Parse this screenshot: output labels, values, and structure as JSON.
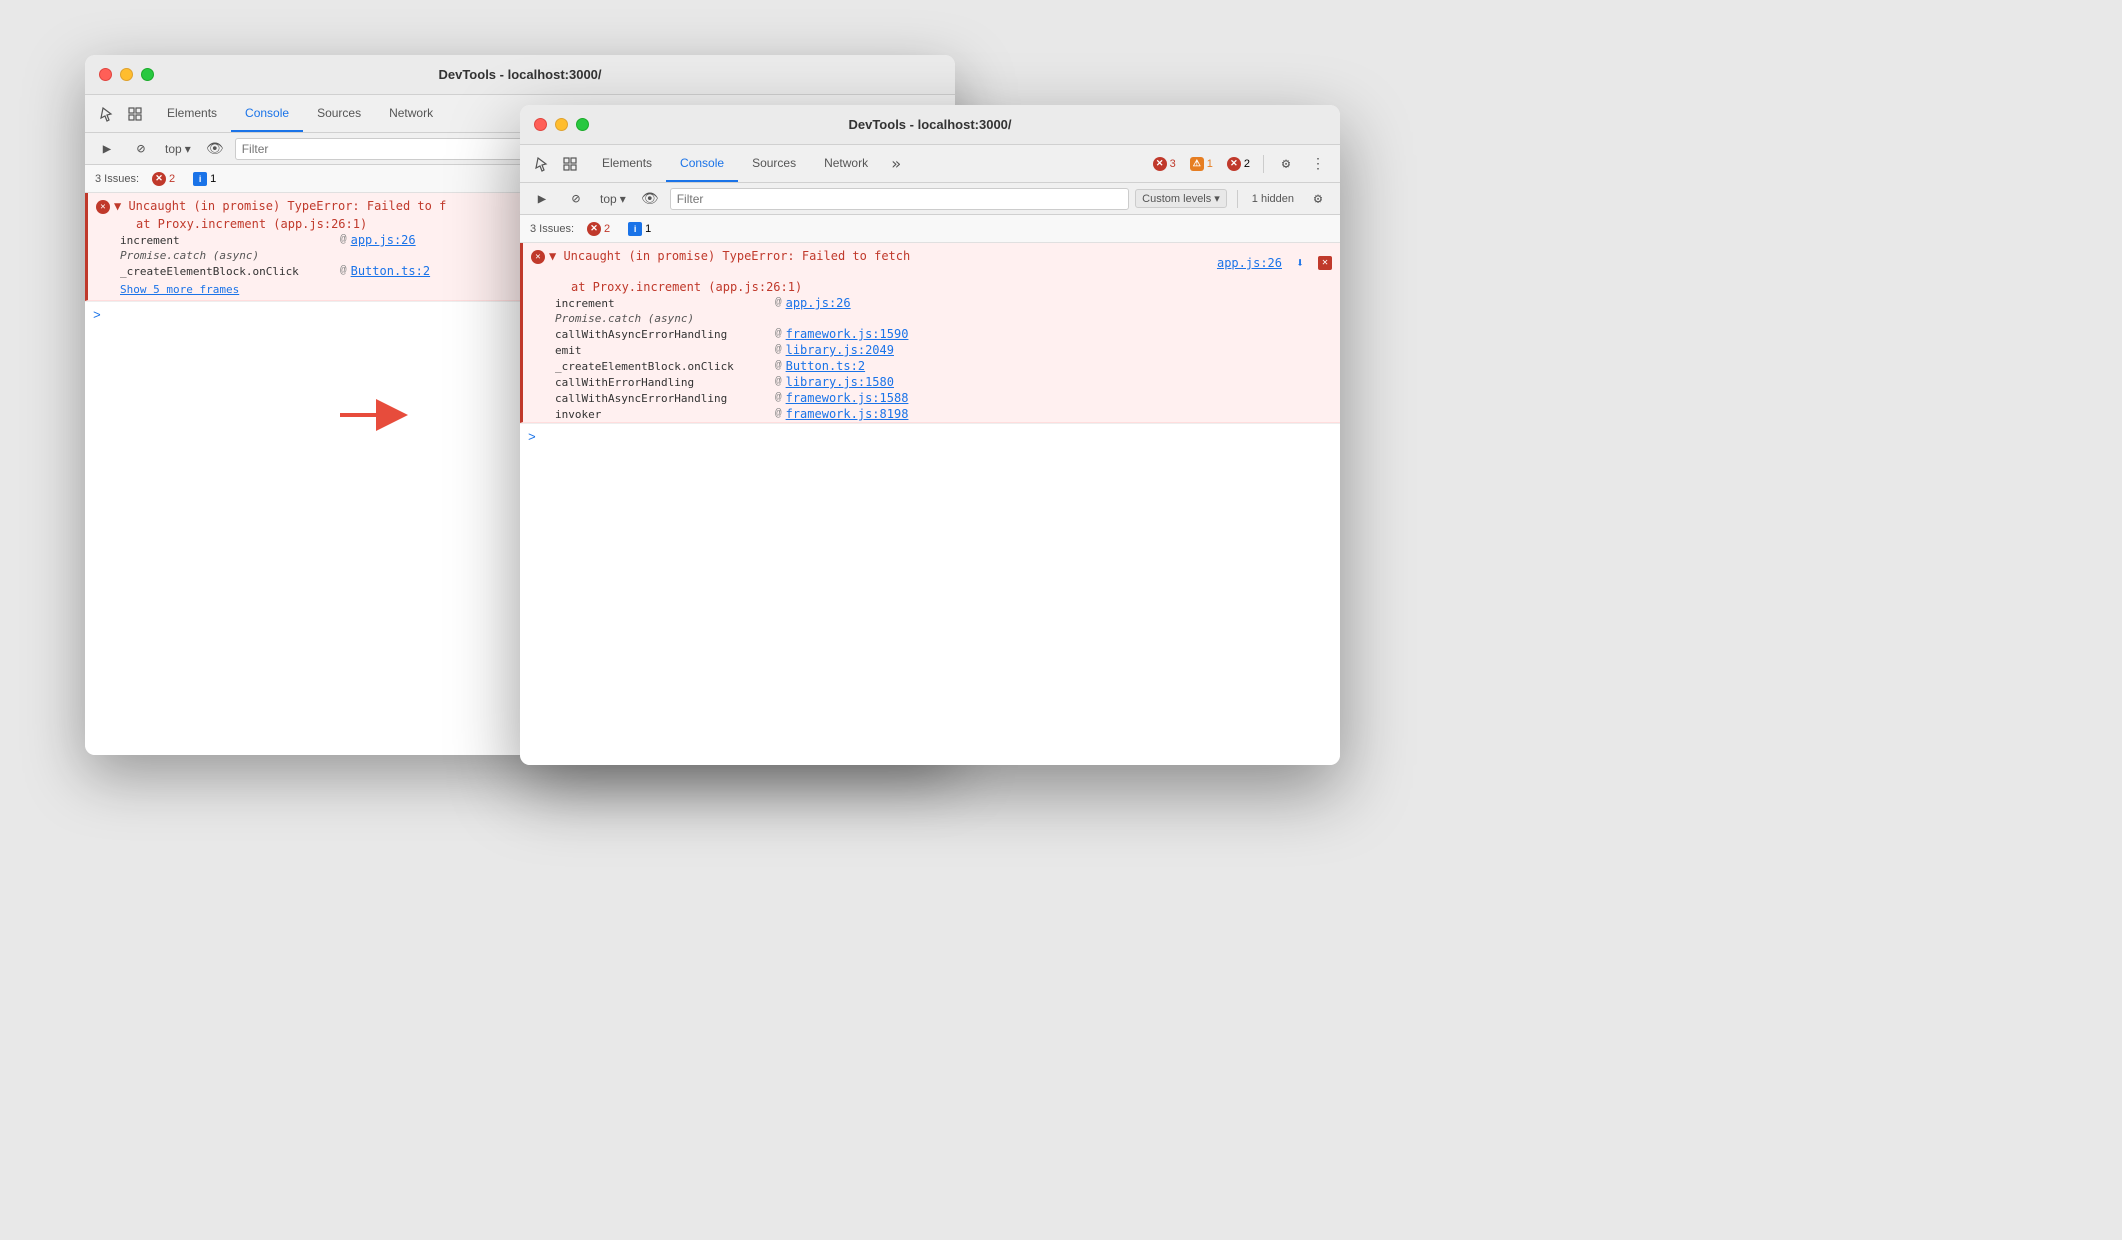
{
  "back_window": {
    "title": "DevTools - localhost:3000/",
    "tabs": [
      "Elements",
      "Console",
      "Sources",
      "Network"
    ],
    "active_tab": "Console",
    "toolbar2": {
      "top_label": "top",
      "filter_placeholder": "Filter"
    },
    "issues": {
      "label": "3 Issues:",
      "error_count": "2",
      "info_count": "1"
    },
    "error": {
      "message": "▼ Uncaught (in promise) TypeError: Failed to f",
      "location": "at Proxy.increment (app.js:26:1)",
      "link": "app.js:26",
      "stack": [
        {
          "fn": "increment",
          "at": "@",
          "file": "app.js:26"
        },
        {
          "fn": "Promise.catch (async)",
          "at": "",
          "file": ""
        },
        {
          "fn": "_createElementBlock.onClick",
          "at": "@",
          "file": "Button.ts:2"
        }
      ],
      "show_more": "Show 5 more frames"
    },
    "prompt": ">"
  },
  "front_window": {
    "title": "DevTools - localhost:3000/",
    "tabs": [
      "Elements",
      "Console",
      "Sources",
      "Network"
    ],
    "active_tab": "Console",
    "toolbar2": {
      "top_label": "top",
      "filter_placeholder": "Filter",
      "custom_levels": "Custom levels",
      "hidden_count": "1 hidden"
    },
    "issues": {
      "label": "3 Issues:",
      "error_count": "2",
      "info_count": "1"
    },
    "badges_right": {
      "error_count": "3",
      "warning_count": "1",
      "info_count": "2"
    },
    "error": {
      "message": "▼ Uncaught (in promise) TypeError: Failed to fetch",
      "location": "at Proxy.increment (app.js:26:1)",
      "link_header": "app.js:26",
      "stack": [
        {
          "fn": "increment",
          "at": "@",
          "file": "app.js:26",
          "link": true
        },
        {
          "fn": "Promise.catch (async)",
          "at": "",
          "file": "",
          "italic": true
        },
        {
          "fn": "callWithAsyncErrorHandling",
          "at": "@",
          "file": "framework.js:1590",
          "link": true
        },
        {
          "fn": "emit",
          "at": "@",
          "file": "library.js:2049",
          "link": true
        },
        {
          "fn": "_createElementBlock.onClick",
          "at": "@",
          "file": "Button.ts:2",
          "link": true
        },
        {
          "fn": "callWithErrorHandling",
          "at": "@",
          "file": "library.js:1580",
          "link": true
        },
        {
          "fn": "callWithAsyncErrorHandling",
          "at": "@",
          "file": "framework.js:1588",
          "link": true
        },
        {
          "fn": "invoker",
          "at": "@",
          "file": "framework.js:8198",
          "link": true
        }
      ]
    },
    "prompt": ">"
  },
  "arrow": {
    "color": "#e74c3c"
  }
}
